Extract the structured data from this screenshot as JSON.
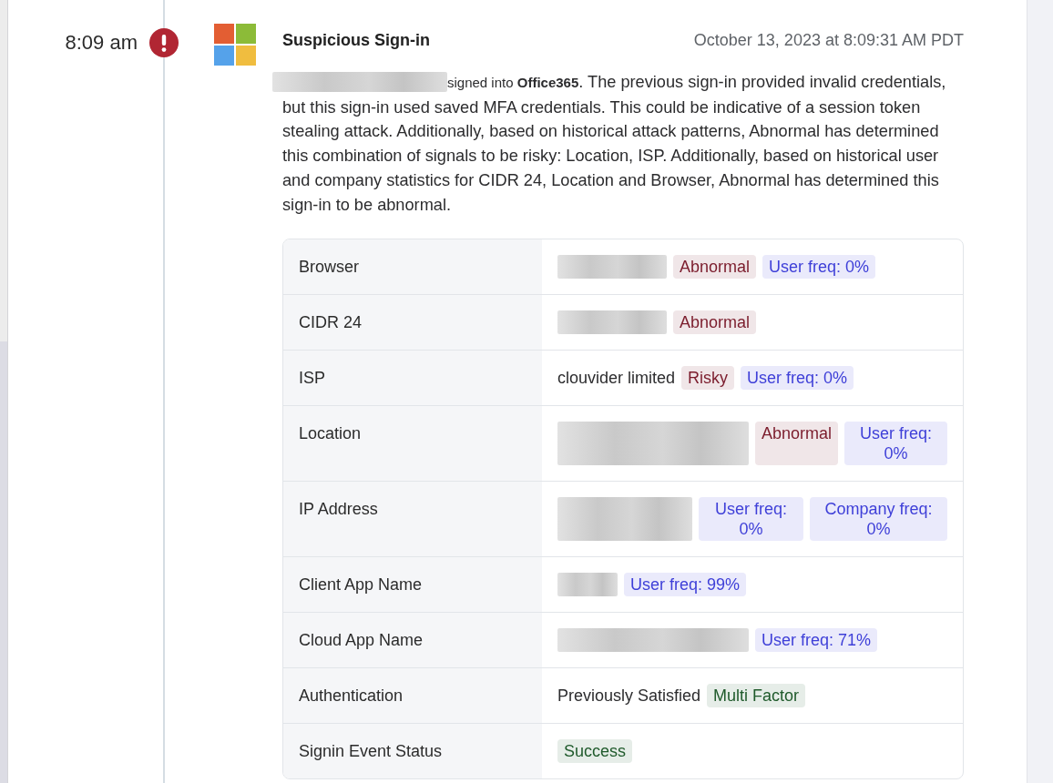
{
  "timeline_entry": {
    "time": "8:09 am",
    "title": "Suspicious Sign-in",
    "timestamp": "October 13, 2023 at 8:09:31 AM PDT",
    "description": {
      "subject_redacted": true,
      "lead": "signed into **Office365**",
      "text": ". The previous sign-in provided invalid credentials, but this sign-in used saved MFA credentials. This could be indicative of a session token stealing attack. Additionally, based on historical attack patterns, Abnormal has determined this combination of signals to be risky: Location, ISP. Additionally, based on historical user and company statistics for CIDR 24, Location and Browser, Abnormal has determined this sign-in to be abnormal."
    },
    "details": [
      {
        "label": "Browser",
        "kind": "redacted-medium",
        "badges": [
          {
            "text": "Abnormal",
            "color": "#7b1c2c"
          },
          {
            "text": "User freq: 0%",
            "color": "#3e3fd8"
          }
        ]
      },
      {
        "label": "CIDR 24",
        "kind": "redacted-medium",
        "badges": [
          {
            "text": "Abnormal",
            "color": "#7b1c2c"
          }
        ]
      },
      {
        "label": "ISP",
        "kind": "text",
        "value": "clouvider limited",
        "badges": [
          {
            "text": "Risky",
            "color": "#7b1c2c"
          },
          {
            "text": "User freq: 0%",
            "color": "#3e3fd8"
          }
        ]
      },
      {
        "label": "Location",
        "kind": "redacted-wide",
        "badges": [
          {
            "text": "Abnormal",
            "color": "#7b1c2c"
          },
          {
            "text": "User freq: 0%",
            "color": "#3e3fd8"
          }
        ]
      },
      {
        "label": "IP Address",
        "kind": "redacted-long",
        "badges": [
          {
            "text": "User freq: 0%",
            "color": "#3e3fd8"
          },
          {
            "text": "Company freq: 0%",
            "color": "#3e3fd8"
          }
        ]
      },
      {
        "label": "Client App Name",
        "kind": "redacted-short",
        "badges": [
          {
            "text": "User freq: 99%",
            "color": "#3e3fd8"
          }
        ]
      },
      {
        "label": "Cloud App Name",
        "kind": "redacted-wide",
        "badges": [
          {
            "text": "User freq: 71%",
            "color": "#3e3fd8"
          }
        ]
      },
      {
        "label": "Authentication",
        "kind": "text",
        "value": "Previously Satisfied",
        "badges": [
          {
            "text": "Multi Factor",
            "color": "#1f5a2b"
          }
        ]
      },
      {
        "label": "Signin Event Status",
        "kind": "text",
        "badges": [
          {
            "text": "Success",
            "color": "#1f5a2b"
          }
        ]
      }
    ]
  }
}
